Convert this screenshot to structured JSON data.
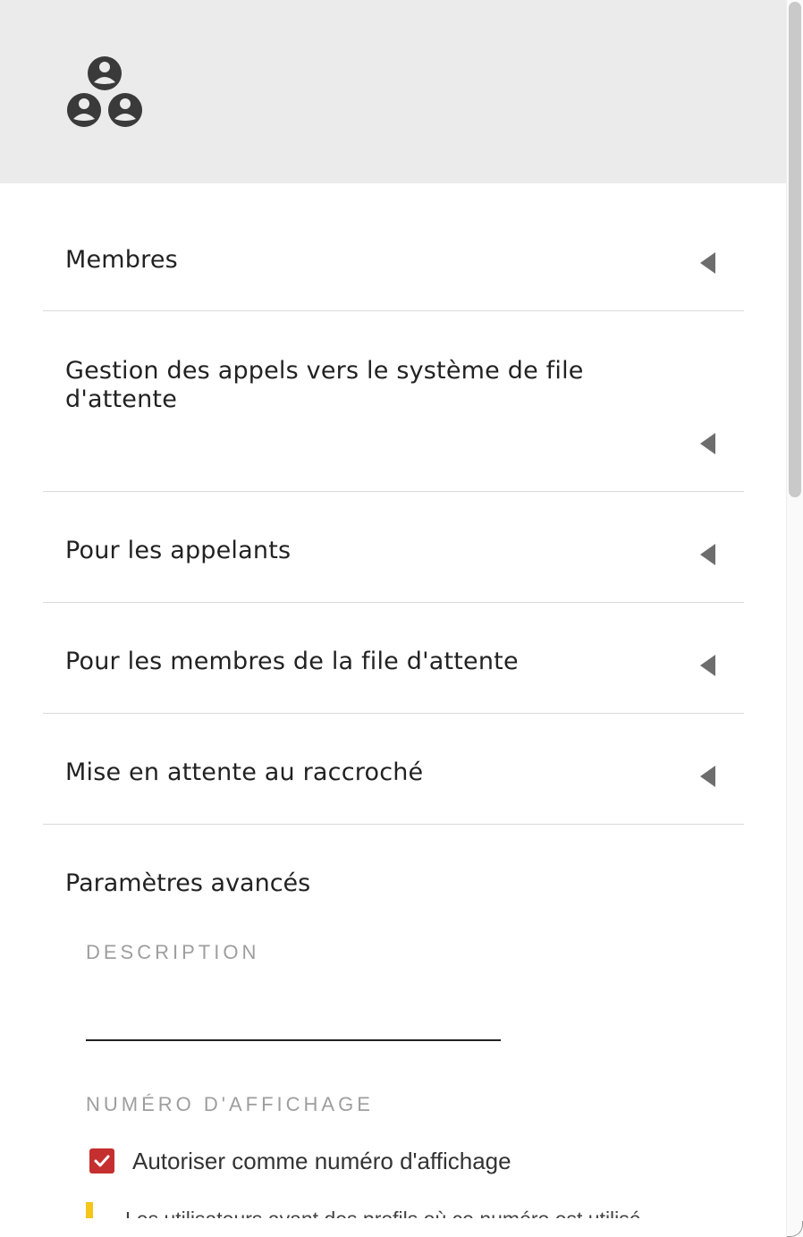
{
  "header": {
    "icon": "group-icon"
  },
  "sections": [
    {
      "title": "Membres"
    },
    {
      "title": "Gestion des appels vers le système de file d'attente"
    },
    {
      "title": "Pour les appelants"
    },
    {
      "title": "Pour les membres de la file d'attente"
    },
    {
      "title": "Mise en attente au raccroché"
    }
  ],
  "advanced": {
    "title": "Paramètres avancés",
    "description_label": "DESCRIPTION",
    "description_value": "",
    "display_number_label": "NUMÉRO D'AFFICHAGE",
    "allow_display_label": "Autoriser comme numéro d'affichage",
    "allow_display_checked": true,
    "warning_text": "Les utilisateurs ayant des profils où ce numéro est utilisé"
  },
  "colors": {
    "header_bg": "#ebebeb",
    "checkbox": "#c62f2f",
    "warning": "#f5c518"
  }
}
